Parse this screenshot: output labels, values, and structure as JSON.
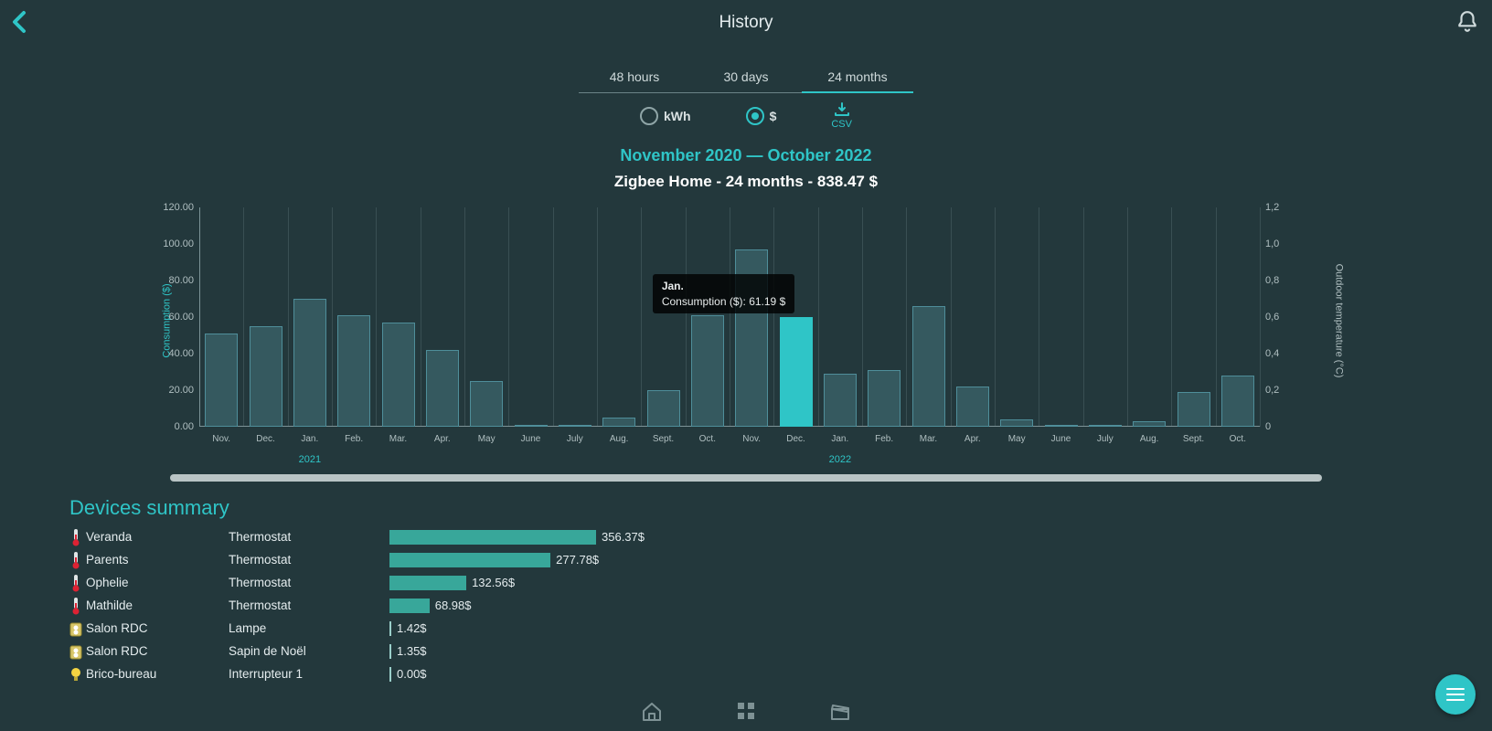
{
  "header": {
    "title": "History"
  },
  "tabs": {
    "items": [
      "48 hours",
      "30 days",
      "24 months"
    ],
    "selected": 2
  },
  "units": {
    "options": [
      "kWh",
      "$"
    ],
    "selected": 1
  },
  "csv": {
    "label": "CSV"
  },
  "chart_header": {
    "range": "November 2020 — October 2022",
    "title": "Zigbee Home - 24 months - 838.47 $"
  },
  "chart_data": {
    "type": "bar",
    "title": "Zigbee Home - 24 months - 838.47 $",
    "xlabel": "",
    "ylabel": "Consumption ($)",
    "ylim": [
      0,
      120
    ],
    "y_ticks": [
      "0.00",
      "20.00",
      "40.00",
      "60.00",
      "80.00",
      "100.00",
      "120.00"
    ],
    "y2label": "Outdoor temperature (°C)",
    "y2lim": [
      0,
      1.2
    ],
    "y2_ticks": [
      "0",
      "0,2",
      "0,4",
      "0,6",
      "0,8",
      "1,0",
      "1,2"
    ],
    "categories": [
      "Nov.",
      "Dec.",
      "Jan.",
      "Feb.",
      "Mar.",
      "Apr.",
      "May",
      "June",
      "July",
      "Aug.",
      "Sept.",
      "Oct.",
      "Nov.",
      "Dec.",
      "Jan.",
      "Feb.",
      "Mar.",
      "Apr.",
      "May",
      "June",
      "July",
      "Aug.",
      "Sept.",
      "Oct."
    ],
    "values": [
      51,
      55,
      70,
      61,
      57,
      42,
      25,
      0,
      0.6,
      5,
      20,
      61.19,
      97,
      60,
      29,
      31,
      66,
      22,
      4,
      0.3,
      0,
      3,
      19,
      28
    ],
    "highlight_index": 13,
    "year_markers": [
      {
        "index": 2,
        "label": "2021"
      },
      {
        "index": 14,
        "label": "2022"
      }
    ]
  },
  "tooltip": {
    "month": "Jan.",
    "line": "Consumption ($): 61.19 $",
    "at_index": 11
  },
  "devices_section": {
    "title": "Devices summary"
  },
  "devices": [
    {
      "icon": "thermo",
      "name": "Veranda",
      "type": "Thermostat",
      "value": 356.37,
      "display": "356.37$"
    },
    {
      "icon": "thermo",
      "name": "Parents",
      "type": "Thermostat",
      "value": 277.78,
      "display": "277.78$"
    },
    {
      "icon": "thermo",
      "name": "Ophelie",
      "type": "Thermostat",
      "value": 132.56,
      "display": "132.56$"
    },
    {
      "icon": "thermo",
      "name": "Mathilde",
      "type": "Thermostat",
      "value": 68.98,
      "display": "68.98$"
    },
    {
      "icon": "plug",
      "name": "Salon RDC",
      "type": "Lampe",
      "value": 1.42,
      "display": "1.42$"
    },
    {
      "icon": "plug",
      "name": "Salon RDC",
      "type": "Sapin de Noël",
      "value": 1.35,
      "display": "1.35$"
    },
    {
      "icon": "bulb",
      "name": "Brico-bureau",
      "type": "Interrupteur 1",
      "value": 0.0,
      "display": "0.00$"
    }
  ],
  "device_bar_max": 356.37,
  "colors": {
    "accent": "#2fc5c7",
    "bar": "#35595f",
    "bar_border": "#4f8e9a",
    "dev_bar": "#38a79a"
  }
}
